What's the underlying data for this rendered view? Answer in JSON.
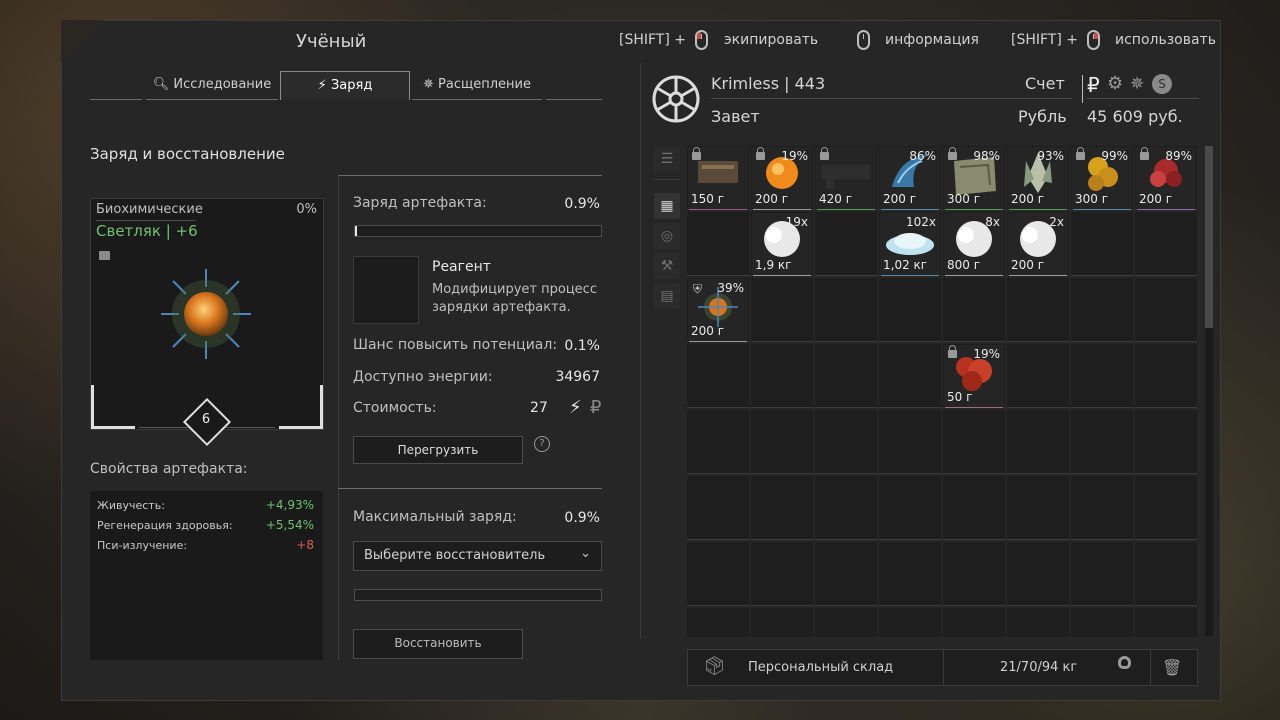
{
  "window": {
    "title": "Учёный"
  },
  "hints": [
    {
      "prefix": "[SHIFT] +",
      "action": "экипировать"
    },
    {
      "prefix": "",
      "action": "информация"
    },
    {
      "prefix": "[SHIFT] +",
      "action": "использовать"
    }
  ],
  "tabs": [
    {
      "label": "Исследование",
      "icon": "search-icon"
    },
    {
      "label": "Заряд",
      "icon": "lightning-icon",
      "active": true
    },
    {
      "label": "Расщепление",
      "icon": "split-icon"
    }
  ],
  "charge": {
    "section_title": "Заряд и восстановление",
    "artifact": {
      "category": "Биохимические",
      "percent": "0%",
      "name": "Светляк | +6",
      "level": "6"
    },
    "artifact_charge_label": "Заряд артефакта:",
    "artifact_charge_value": "0.9%",
    "artifact_charge_fill": 0.009,
    "reagent_title": "Реагент",
    "reagent_desc": "Модифицирует процесс зарядки артефакта.",
    "potential_label": "Шанс повысить потенциал:",
    "potential_value": "0.1%",
    "energy_label": "Доступно энергии:",
    "energy_value": "34967",
    "cost_label": "Стоимость:",
    "cost_value": "27",
    "overload_button": "Перегрузить",
    "help": "?",
    "properties_title": "Свойства артефакта:",
    "properties": [
      {
        "name": "Живучесть:",
        "value": "+4,93%",
        "tone": "green"
      },
      {
        "name": "Регенерация здоровья:",
        "value": "+5,54%",
        "tone": "green"
      },
      {
        "name": "Пси-излучение:",
        "value": "+8",
        "tone": "red"
      }
    ],
    "max_charge_label": "Максимальный заряд:",
    "max_charge_value": "0.9%",
    "restorer_placeholder": "Выберите восстановитель",
    "restore_button": "Восстановить"
  },
  "player": {
    "name_level": "Krimless | 443",
    "faction": "Завет",
    "account_label": "Счет",
    "currency_label": "Рубль",
    "balance": "45 609 руб.",
    "currency_symbol": "₽"
  },
  "inventory": {
    "items": [
      {
        "row": 0,
        "col": 0,
        "weight": "150 г",
        "percent": "",
        "locked": true,
        "art": "crate"
      },
      {
        "row": 0,
        "col": 1,
        "weight": "200 г",
        "percent": "19%",
        "locked": true,
        "art": "orange-orb"
      },
      {
        "row": 0,
        "col": 2,
        "weight": "420 г",
        "percent": "",
        "locked": true,
        "art": "gun-part"
      },
      {
        "row": 0,
        "col": 3,
        "weight": "200 г",
        "percent": "86%",
        "locked": false,
        "art": "blue-claw"
      },
      {
        "row": 0,
        "col": 4,
        "weight": "300 г",
        "percent": "98%",
        "locked": true,
        "art": "map"
      },
      {
        "row": 0,
        "col": 5,
        "weight": "200 г",
        "percent": "93%",
        "locked": false,
        "art": "crystal"
      },
      {
        "row": 0,
        "col": 6,
        "weight": "300 г",
        "percent": "99%",
        "locked": true,
        "art": "yellow-coral"
      },
      {
        "row": 0,
        "col": 7,
        "weight": "200 г",
        "percent": "89%",
        "locked": true,
        "art": "red-flower"
      },
      {
        "row": 1,
        "col": 1,
        "weight": "1,9 кг",
        "percent": "19x",
        "locked": false,
        "art": "white-cloud"
      },
      {
        "row": 1,
        "col": 3,
        "weight": "1,02 кг",
        "percent": "102x",
        "locked": false,
        "art": "white-pile"
      },
      {
        "row": 1,
        "col": 4,
        "weight": "800 г",
        "percent": "8x",
        "locked": false,
        "art": "white-cloud"
      },
      {
        "row": 1,
        "col": 5,
        "weight": "200 г",
        "percent": "2x",
        "locked": false,
        "art": "white-cloud"
      },
      {
        "row": 2,
        "col": 0,
        "weight": "200 г",
        "percent": "39%",
        "locked": false,
        "art": "firefly",
        "shield": true
      },
      {
        "row": 3,
        "col": 4,
        "weight": "50 г",
        "percent": "19%",
        "locked": true,
        "art": "red-coral"
      }
    ],
    "storage_label": "Персональный склад",
    "weight_summary": "21/70/94 кг"
  }
}
